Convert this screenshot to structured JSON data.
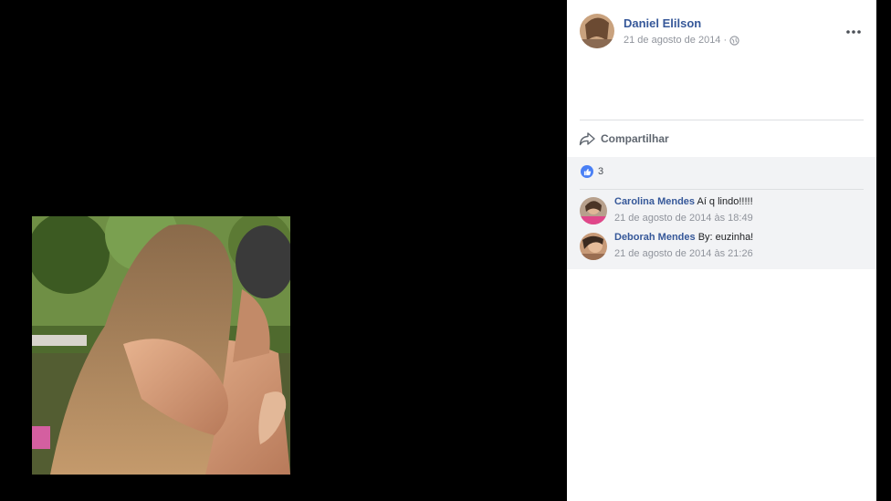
{
  "post": {
    "author": "Daniel Elilson",
    "date": "21 de agosto de 2014",
    "separator": "·",
    "share_label": "Compartilhar",
    "likes_count": "3"
  },
  "comments": [
    {
      "name": "Carolina Mendes",
      "text": "Aí q lindo!!!!!",
      "time": "21 de agosto de 2014 às 18:49"
    },
    {
      "name": "Deborah Mendes",
      "text": "By: euzinha!",
      "time": "21 de agosto de 2014 às 21:26"
    }
  ],
  "colors": {
    "link": "#365899",
    "meta": "#90949c",
    "like_badge": "#4a80f5",
    "comments_bg": "#f2f3f5"
  }
}
